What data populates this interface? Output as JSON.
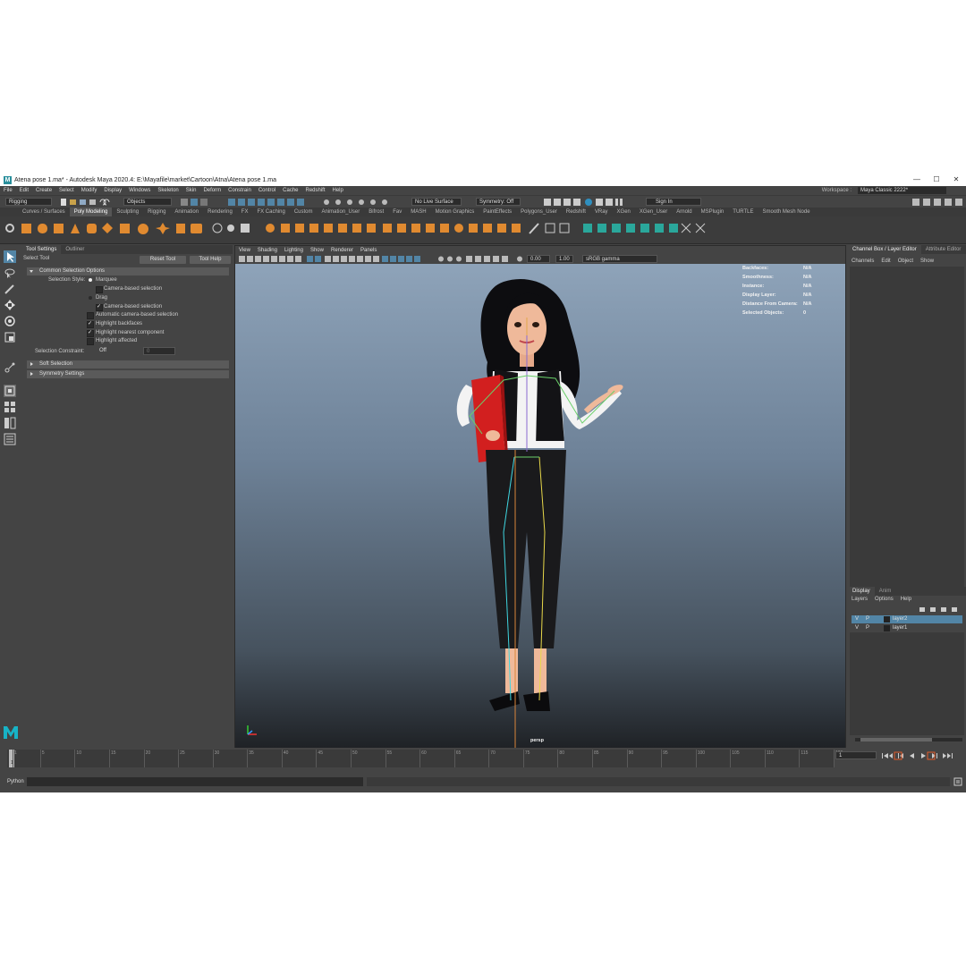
{
  "window": {
    "title": "Atena pose 1.ma* - Autodesk Maya 2020.4: E:\\Mayafile\\market\\Cartoon\\Atna\\Atena pose 1.ma",
    "logo_letter": "M",
    "controls": [
      "—",
      "☐",
      "✕"
    ]
  },
  "menubar": {
    "items": [
      "File",
      "Edit",
      "Create",
      "Select",
      "Modify",
      "Display",
      "Windows",
      "Skeleton",
      "Skin",
      "Deform",
      "Constrain",
      "Control",
      "Cache",
      "Redshift",
      "Help"
    ],
    "workspace_label": "Workspace :",
    "workspace_value": "Maya Classic 2222*"
  },
  "statusline": {
    "menuset": "Rigging",
    "objects": "Objects",
    "live_surface": "No Live Surface",
    "symmetry": "Symmetry: Off",
    "sign_in": "Sign In"
  },
  "shelf_tabs": [
    "Curves / Surfaces",
    "Poly Modeling",
    "Sculpting",
    "Rigging",
    "Animation",
    "Rendering",
    "FX",
    "FX Caching",
    "Custom",
    "Animation_User",
    "Bifrost",
    "Fav",
    "MASH",
    "Motion Graphics",
    "PaintEffects",
    "Polygons_User",
    "Redshift",
    "VRay",
    "XGen",
    "XGen_User",
    "Arnold",
    "MSPlugin",
    "TURTLE",
    "Smooth Mesh Node"
  ],
  "shelf_active": "Poly Modeling",
  "tool_settings": {
    "tabs": [
      "Tool Settings",
      "Outliner"
    ],
    "tool_name": "Select Tool",
    "reset_label": "Reset Tool",
    "help_label": "Tool Help",
    "section_common": "Common Selection Options",
    "selection_style_label": "Selection Style:",
    "marquee": "Marquee",
    "camera_based_1": "Camera-based selection",
    "drag": "Drag",
    "camera_based_2": "Camera-based selection",
    "auto_camera": "Automatic camera-based selection",
    "highlight_backfaces": "Highlight backfaces",
    "highlight_nearest": "Highlight nearest component",
    "highlight_affected": "Highlight affected",
    "constraint_label": "Selection Constraint:",
    "constraint_value": "Off",
    "constraint_num": "0",
    "section_soft": "Soft Selection",
    "section_symmetry": "Symmetry Settings"
  },
  "viewport": {
    "menu": [
      "View",
      "Shading",
      "Lighting",
      "Show",
      "Renderer",
      "Panels"
    ],
    "exposure": "0.00",
    "gamma": "1.00",
    "colorspace": "sRGB gamma",
    "camera_label": "persp",
    "hud": [
      {
        "label": "Backfaces:",
        "value": "N/A"
      },
      {
        "label": "Smoothness:",
        "value": "N/A"
      },
      {
        "label": "Instance:",
        "value": "N/A"
      },
      {
        "label": "Display Layer:",
        "value": "N/A"
      },
      {
        "label": "Distance From Camera:",
        "value": "N/A"
      },
      {
        "label": "Selected Objects:",
        "value": "0"
      }
    ]
  },
  "channel_box": {
    "tabs": [
      "Channel Box / Layer Editor",
      "Attribute Editor"
    ],
    "menu": [
      "Channels",
      "Edit",
      "Object",
      "Show"
    ]
  },
  "layer_editor": {
    "tabs": [
      "Display",
      "Anim"
    ],
    "menu": [
      "Layers",
      "Options",
      "Help"
    ],
    "layers": [
      {
        "v": "V",
        "p": "P",
        "name": "layer2",
        "selected": true
      },
      {
        "v": "V",
        "p": "P",
        "name": "layer1",
        "selected": false
      }
    ]
  },
  "timeline": {
    "ticks": [
      "1",
      "5",
      "10",
      "15",
      "20",
      "25",
      "30",
      "35",
      "40",
      "45",
      "50",
      "55",
      "60",
      "65",
      "70",
      "75",
      "80",
      "85",
      "90",
      "95",
      "100",
      "105",
      "110",
      "115",
      "120"
    ],
    "current_frame": "1",
    "marker_label": "1"
  },
  "command_line": {
    "language": "Python"
  },
  "colors": {
    "accent": "#5285a6",
    "folder_red": "#d21f1f",
    "maya_logo": "#17b3c6"
  }
}
